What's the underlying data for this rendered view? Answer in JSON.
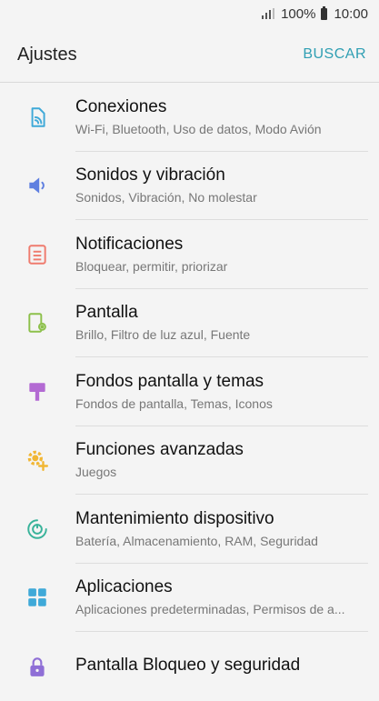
{
  "status_bar": {
    "battery": "100%",
    "time": "10:00"
  },
  "header": {
    "title": "Ajustes",
    "search_label": "BUSCAR"
  },
  "colors": {
    "accent": "#2f9fb3"
  },
  "settings": [
    {
      "label": "Conexiones",
      "sub": "Wi-Fi, Bluetooth, Uso de datos, Modo Avión",
      "icon": "connections-icon",
      "color": "#3fa9d8"
    },
    {
      "label": "Sonidos y vibración",
      "sub": "Sonidos, Vibración, No molestar",
      "icon": "speaker-icon",
      "color": "#5f7fe0"
    },
    {
      "label": "Notificaciones",
      "sub": "Bloquear, permitir, priorizar",
      "icon": "notifications-icon",
      "color": "#ef7b6e"
    },
    {
      "label": "Pantalla",
      "sub": "Brillo, Filtro de luz azul, Fuente",
      "icon": "display-icon",
      "color": "#8cc04a"
    },
    {
      "label": "Fondos pantalla y temas",
      "sub": "Fondos de pantalla, Temas, Iconos",
      "icon": "wallpaper-icon",
      "color": "#b36ad3"
    },
    {
      "label": "Funciones avanzadas",
      "sub": "Juegos",
      "icon": "advanced-gear-icon",
      "color": "#f1b633"
    },
    {
      "label": "Mantenimiento dispositivo",
      "sub": "Batería, Almacenamiento, RAM, Seguridad",
      "icon": "maintenance-icon",
      "color": "#39b39a"
    },
    {
      "label": "Aplicaciones",
      "sub": "Aplicaciones predeterminadas, Permisos de a...",
      "icon": "apps-grid-icon",
      "color": "#3fa9d8"
    },
    {
      "label": "Pantalla Bloqueo y seguridad",
      "sub": "",
      "icon": "lock-icon",
      "color": "#8f6fd6"
    }
  ]
}
